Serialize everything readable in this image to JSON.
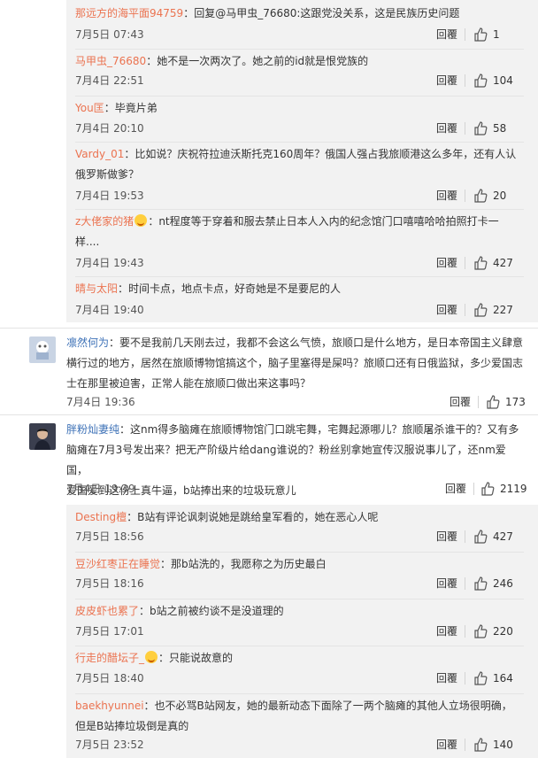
{
  "reply_label": "回覆",
  "colors": {
    "username": "#eb7350",
    "username_blue": "#3e72b7",
    "reply_bg": "#f2f2f2"
  },
  "group1": [
    {
      "user": "那远方的海平面94759",
      "text": "：回复@马甲虫_76680:这跟党没关系，这是民族历史问题",
      "time": "7月5日 07:43",
      "likes": "1"
    },
    {
      "user": "马甲虫_76680",
      "text": "：她不是一次两次了。她之前的id就是恨党族的",
      "time": "7月4日 22:51",
      "likes": "104"
    },
    {
      "user": "You匡",
      "text": "：毕竟片弟",
      "time": "7月4日 20:10",
      "likes": "58"
    },
    {
      "user": "Vardy_01",
      "text": "：比如说？庆祝符拉迪沃斯托克160周年？俄国人强占我旅顺港这么多年，还有人认",
      "text2": "俄罗斯做爹？",
      "time": "7月4日 19:53",
      "likes": "20"
    },
    {
      "user": "z大佬家的猪",
      "text": "：nt程度等于穿着和服去禁止日本人入内的纪念馆门口嘻嘻哈哈拍照打卡一",
      "text2": "样....",
      "emoji": "laugh-emoji",
      "time": "7月4日 19:43",
      "likes": "427"
    },
    {
      "user": "晴与太阳",
      "text": "：时间卡点，地点卡点，好奇她是不是要尼的人",
      "time": "7月4日 19:40",
      "likes": "227"
    }
  ],
  "comment1": {
    "user": "凛然何为",
    "lines": [
      "：要不是我前几天刚去过，我都不会这么气愤，旅顺口是什么地方，是日本帝国主义肆意",
      "横行过的地方，居然在旅顺博物馆搞这个，脑子里塞得是屎吗？旅顺口还有日俄监狱，多少爱国志",
      "士在那里被迫害，正常人能在旅顺口做出来这事吗？"
    ],
    "time": "7月4日 19:36",
    "likes": "173"
  },
  "comment2": {
    "user": "胖粉灿妻纯",
    "lines": [
      "：这nm得多脑瘫在旅顺博物馆门口跳宅舞，宅舞起源哪儿？旅顺屠杀谁干的？又有多",
      "脑瘫在7月3号发出来？把无产阶级片给dang谁说的？粉丝别拿她宣传汉服说事儿了，还nm爱国，",
      "爱国爱到这份上真牛逼，b站捧出来的垃圾玩意儿"
    ],
    "time": "7月4日 19:39",
    "likes": "2119"
  },
  "group2": [
    {
      "user": "Desting檀",
      "text": "：B站有评论讽刺说她是跳给皇军看的，她在恶心人呢",
      "time": "7月5日 18:56",
      "likes": "427"
    },
    {
      "user": "豆沙红枣正在睡觉",
      "text": "：那b站洗的，我愿称之为历史最白",
      "time": "7月5日 18:16",
      "likes": "246"
    },
    {
      "user": "皮皮虾也累了",
      "text": "：b站之前被约谈不是没道理的",
      "time": "7月5日 17:01",
      "likes": "220"
    },
    {
      "user": "行走的醋坛子_",
      "text": "：只能说故意的",
      "emoji": "laugh-emoji",
      "time": "7月5日 18:40",
      "likes": "164"
    },
    {
      "user": "baekhyunnei",
      "text": "：也不必骂B站网友，她的最新动态下面除了一两个脑瘫的其他人立场很明确，",
      "text2": "但是B站捧垃圾倒是真的",
      "time": "7月5日 23:52",
      "likes": "140"
    }
  ]
}
